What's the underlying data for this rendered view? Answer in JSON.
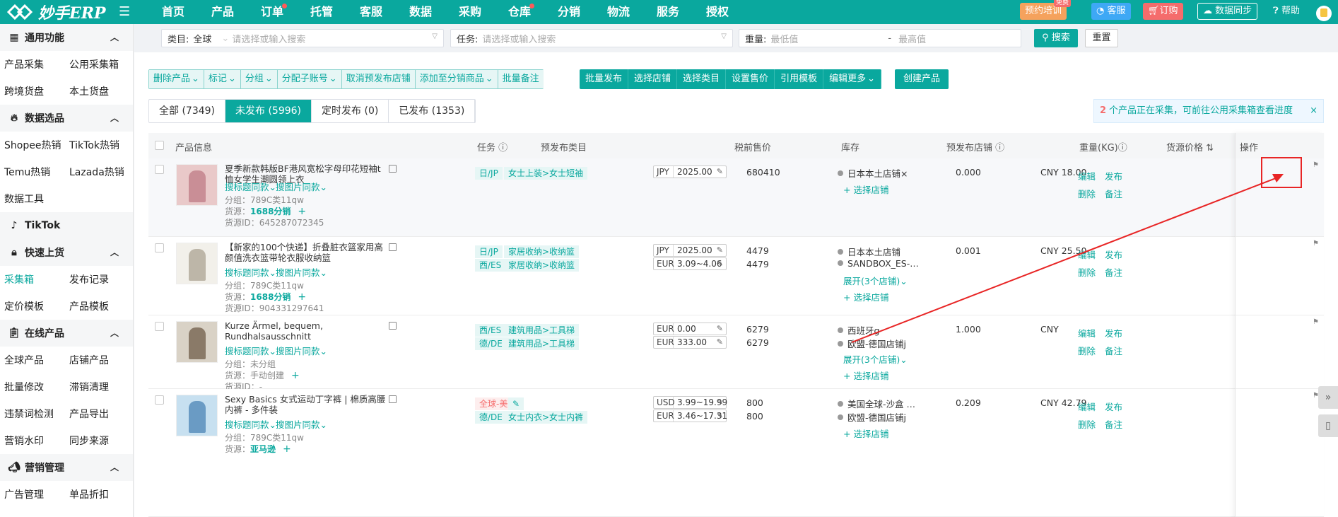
{
  "nav": {
    "logo": "妙手ERP",
    "items": [
      {
        "label": "首页",
        "dot": false
      },
      {
        "label": "产品",
        "dot": false
      },
      {
        "label": "订单",
        "dot": true
      },
      {
        "label": "托管",
        "dot": false
      },
      {
        "label": "客服",
        "dot": false
      },
      {
        "label": "数据",
        "dot": false
      },
      {
        "label": "采购",
        "dot": false
      },
      {
        "label": "仓库",
        "dot": true
      },
      {
        "label": "分销",
        "dot": false
      },
      {
        "label": "物流",
        "dot": false
      },
      {
        "label": "服务",
        "dot": false
      },
      {
        "label": "授权",
        "dot": false
      }
    ],
    "training": "预约培训",
    "free_badge": "免费",
    "service": "客服",
    "order": "订购",
    "sync": "数据同步",
    "help": "帮助"
  },
  "sidebar": {
    "sections": [
      {
        "title": "通用功能",
        "icon": "grid-icon",
        "items": [
          "产品采集",
          "公用采集箱",
          "跨境货盘",
          "本土货盘"
        ]
      },
      {
        "title": "数据选品",
        "icon": "flame-icon",
        "items": [
          "Shopee热销",
          "TikTok热销",
          "Temu热销",
          "Lazada热销",
          "数据工具"
        ]
      },
      {
        "title": "TikTok",
        "icon": "tiktok-icon",
        "items": []
      },
      {
        "title": "快速上货",
        "icon": "bag-icon",
        "items": [
          "采集箱",
          "发布记录",
          "定价模板",
          "产品模板"
        ]
      },
      {
        "title": "在线产品",
        "icon": "clipboard-icon",
        "items": [
          "全球产品",
          "店铺产品",
          "批量修改",
          "滞销清理",
          "违禁词检测",
          "产品导出",
          "营销水印",
          "同步来源"
        ]
      },
      {
        "title": "营销管理",
        "icon": "megaphone-icon",
        "items": [
          "广告管理",
          "单品折扣"
        ]
      }
    ],
    "active_item": "采集箱"
  },
  "filter": {
    "category_label": "类目:",
    "category_value": "全球",
    "category_placeholder": "请选择或输入搜索",
    "task_label": "任务:",
    "task_placeholder": "请选择或输入搜索",
    "weight_label": "重量:",
    "weight_min": "最低值",
    "weight_sep": "-",
    "weight_max": "最高值",
    "search": "搜索",
    "reset": "重置"
  },
  "toolbar": {
    "light": [
      "删除产品",
      "标记",
      "分组",
      "分配子账号",
      "取消预发布店铺",
      "添加至分销商品",
      "批量备注"
    ],
    "light_dropdown": [
      true,
      true,
      true,
      true,
      false,
      true,
      false
    ],
    "dark": [
      "批量发布",
      "选择店铺",
      "选择类目",
      "设置售价",
      "引用模板",
      "编辑更多"
    ],
    "create": "创建产品"
  },
  "tabs": [
    "全部 (7349)",
    "未发布 (5996)",
    "定时发布 (0)",
    "已发布 (1353)"
  ],
  "notice": {
    "count": "2",
    "text": "个产品正在采集，可前往公用采集箱查看进度"
  },
  "columns": {
    "product": "产品信息",
    "task": "任务",
    "category": "预发布类目",
    "price": "税前售价",
    "stock": "库存",
    "shops": "预发布店铺",
    "weight": "重量(KG)",
    "source_price": "货源价格",
    "ops": "操作"
  },
  "sync_title": "搜标题同款",
  "sync_image": "搜图片同款",
  "op_labels": {
    "edit": "编辑",
    "publish": "发布",
    "delete": "删除",
    "note": "备注"
  },
  "select_shop": "选择店铺",
  "rows": [
    {
      "title": "夏季新款韩版BF港风宽松字母印花短袖t恤女学生潮圆领上衣",
      "group": "分组：789C类11qw",
      "source": "货源：",
      "source_link": "1688分销",
      "source_id": "货源ID：645287072345",
      "cats": [
        {
          "site": "日/JP",
          "path": "女士上装>女士短袖",
          "red": false
        }
      ],
      "prices": [
        {
          "cur": "JPY",
          "val": "2025.00"
        }
      ],
      "stocks": [
        "680410"
      ],
      "shops": [
        "日本本土店铺"
      ],
      "expand": "",
      "weight": "0.000",
      "src_price": "CNY 18.00"
    },
    {
      "title": "【新家的100个快递】折叠脏衣篮家用高颜值洗衣篮带轮衣服收纳篮",
      "group": "分组：789C类11qw",
      "source": "货源：",
      "source_link": "1688分销",
      "source_id": "货源ID：904331297641",
      "cats": [
        {
          "site": "日/JP",
          "path": "家居收纳>收纳篮",
          "red": false
        },
        {
          "site": "西/ES",
          "path": "家居收纳>收纳篮",
          "red": false
        }
      ],
      "prices": [
        {
          "cur": "JPY",
          "val": "2025.00"
        },
        {
          "cur": "EUR",
          "val": "3.09~4.06"
        }
      ],
      "stocks": [
        "4479",
        "4479"
      ],
      "shops": [
        "日本本土店铺",
        "SANDBOX_ES-…"
      ],
      "expand": "展开(3个店铺)",
      "weight": "0.001",
      "src_price": "CNY 25.50"
    },
    {
      "title": "Kurze Ärmel, bequem, Rundhalsausschnitt",
      "group": "分组：未分组",
      "source": "货源：手动创建",
      "source_link": "",
      "source_id": "货源ID：-",
      "cats": [
        {
          "site": "西/ES",
          "path": "建筑用品>工具梯",
          "red": false
        },
        {
          "site": "德/DE",
          "path": "建筑用品>工具梯",
          "red": false
        }
      ],
      "prices": [
        {
          "cur": "EUR",
          "val": "0.00"
        },
        {
          "cur": "EUR",
          "val": "333.00"
        }
      ],
      "stocks": [
        "6279",
        "6279"
      ],
      "shops": [
        "西班牙g",
        "欧盟-德国店铺j"
      ],
      "expand": "展开(3个店铺)",
      "weight": "1.000",
      "src_price": "CNY"
    },
    {
      "title": "Sexy Basics 女式运动丁字裤 | 棉质高腰内裤 - 多件装",
      "group": "分组：789C类11qw",
      "source": "货源：",
      "source_link": "亚马逊",
      "source_id": "",
      "cats": [
        {
          "site": "全球-美国",
          "path": "",
          "red": true
        },
        {
          "site": "德/DE",
          "path": "女士内衣>女士内裤",
          "red": false
        }
      ],
      "prices": [
        {
          "cur": "USD",
          "val": "3.99~19.99"
        },
        {
          "cur": "EUR",
          "val": "3.46~17.31"
        }
      ],
      "stocks": [
        "800",
        "800"
      ],
      "shops": [
        "美国全球-沙盒 …",
        "欧盟-德国店铺j"
      ],
      "expand": "",
      "weight": "0.209",
      "src_price": "CNY 42.79"
    }
  ]
}
